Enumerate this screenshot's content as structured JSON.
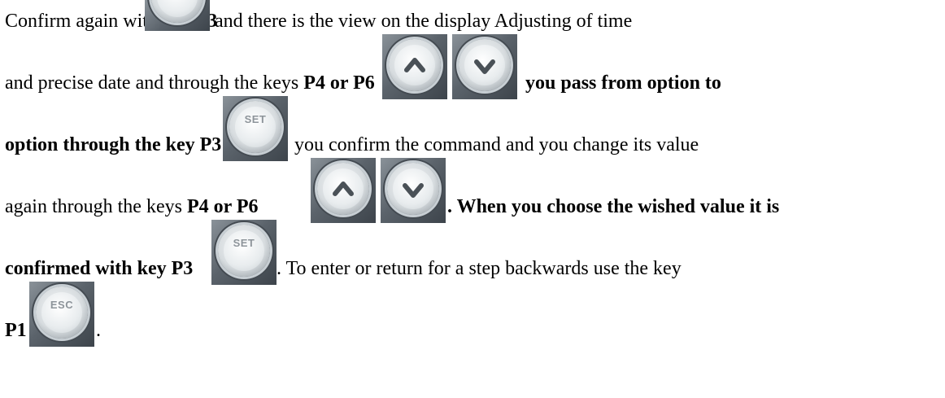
{
  "line1": {
    "t1": "Confirm again with key ",
    "b1": "P3",
    "t2": " and there is the view on the display Adjusting of  time"
  },
  "line2": {
    "t1": "and precise date and through the keys ",
    "b1": "P4 or P6",
    "b2": "you pass from  option to"
  },
  "line3": {
    "b1": "option through the key P3",
    "t1": "you confirm the command and you change its value"
  },
  "line4": {
    "t1": "again through the keys ",
    "b1": "P4 or P6",
    "b2": ". When you choose the wished value it is"
  },
  "line5": {
    "b1": "confirmed with key P3",
    "t1": ". To enter or return for a step backwards use the key"
  },
  "line6": {
    "b1": "P1",
    "t1": "."
  },
  "keys": {
    "set_label": "SET",
    "esc_label": "ESC",
    "up_icon": "arrow-up-icon",
    "down_icon": "arrow-down-icon"
  }
}
